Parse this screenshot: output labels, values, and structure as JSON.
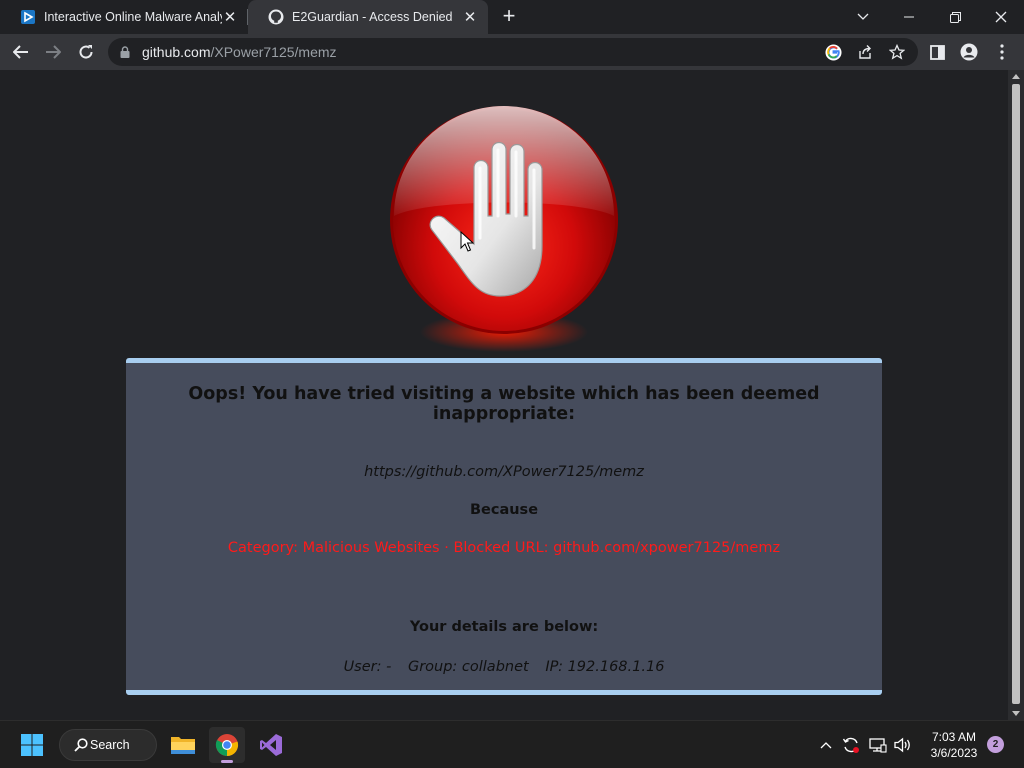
{
  "browser": {
    "tabs": [
      {
        "title": "Interactive Online Malware Analy",
        "icon": "anyrun-icon"
      },
      {
        "title": "E2Guardian - Access Denied",
        "icon": "github-icon"
      }
    ],
    "address": {
      "host": "github.com",
      "path": "/XPower7125/memz"
    }
  },
  "page": {
    "headline": "Oops! You have tried visiting a website which has been deemed inappropriate:",
    "blocked_url": "https://github.com/XPower7125/memz",
    "because": "Because",
    "reason": "Category: Malicious Websites · Blocked URL: github.com/xpower7125/memz",
    "details_title": "Your details are below:",
    "user": "User: -",
    "group": "Group: collabnet",
    "ip": "IP: 192.168.1.16"
  },
  "taskbar": {
    "search_label": "Search",
    "time": "7:03 AM",
    "date": "3/6/2023",
    "notification_count": "2"
  },
  "colors": {
    "page_bg": "#202124",
    "panel_bg": "#464c5c",
    "panel_border": "#a8cef0",
    "reason_text": "#ff1a1a",
    "stop_red": "#d10a0a"
  }
}
